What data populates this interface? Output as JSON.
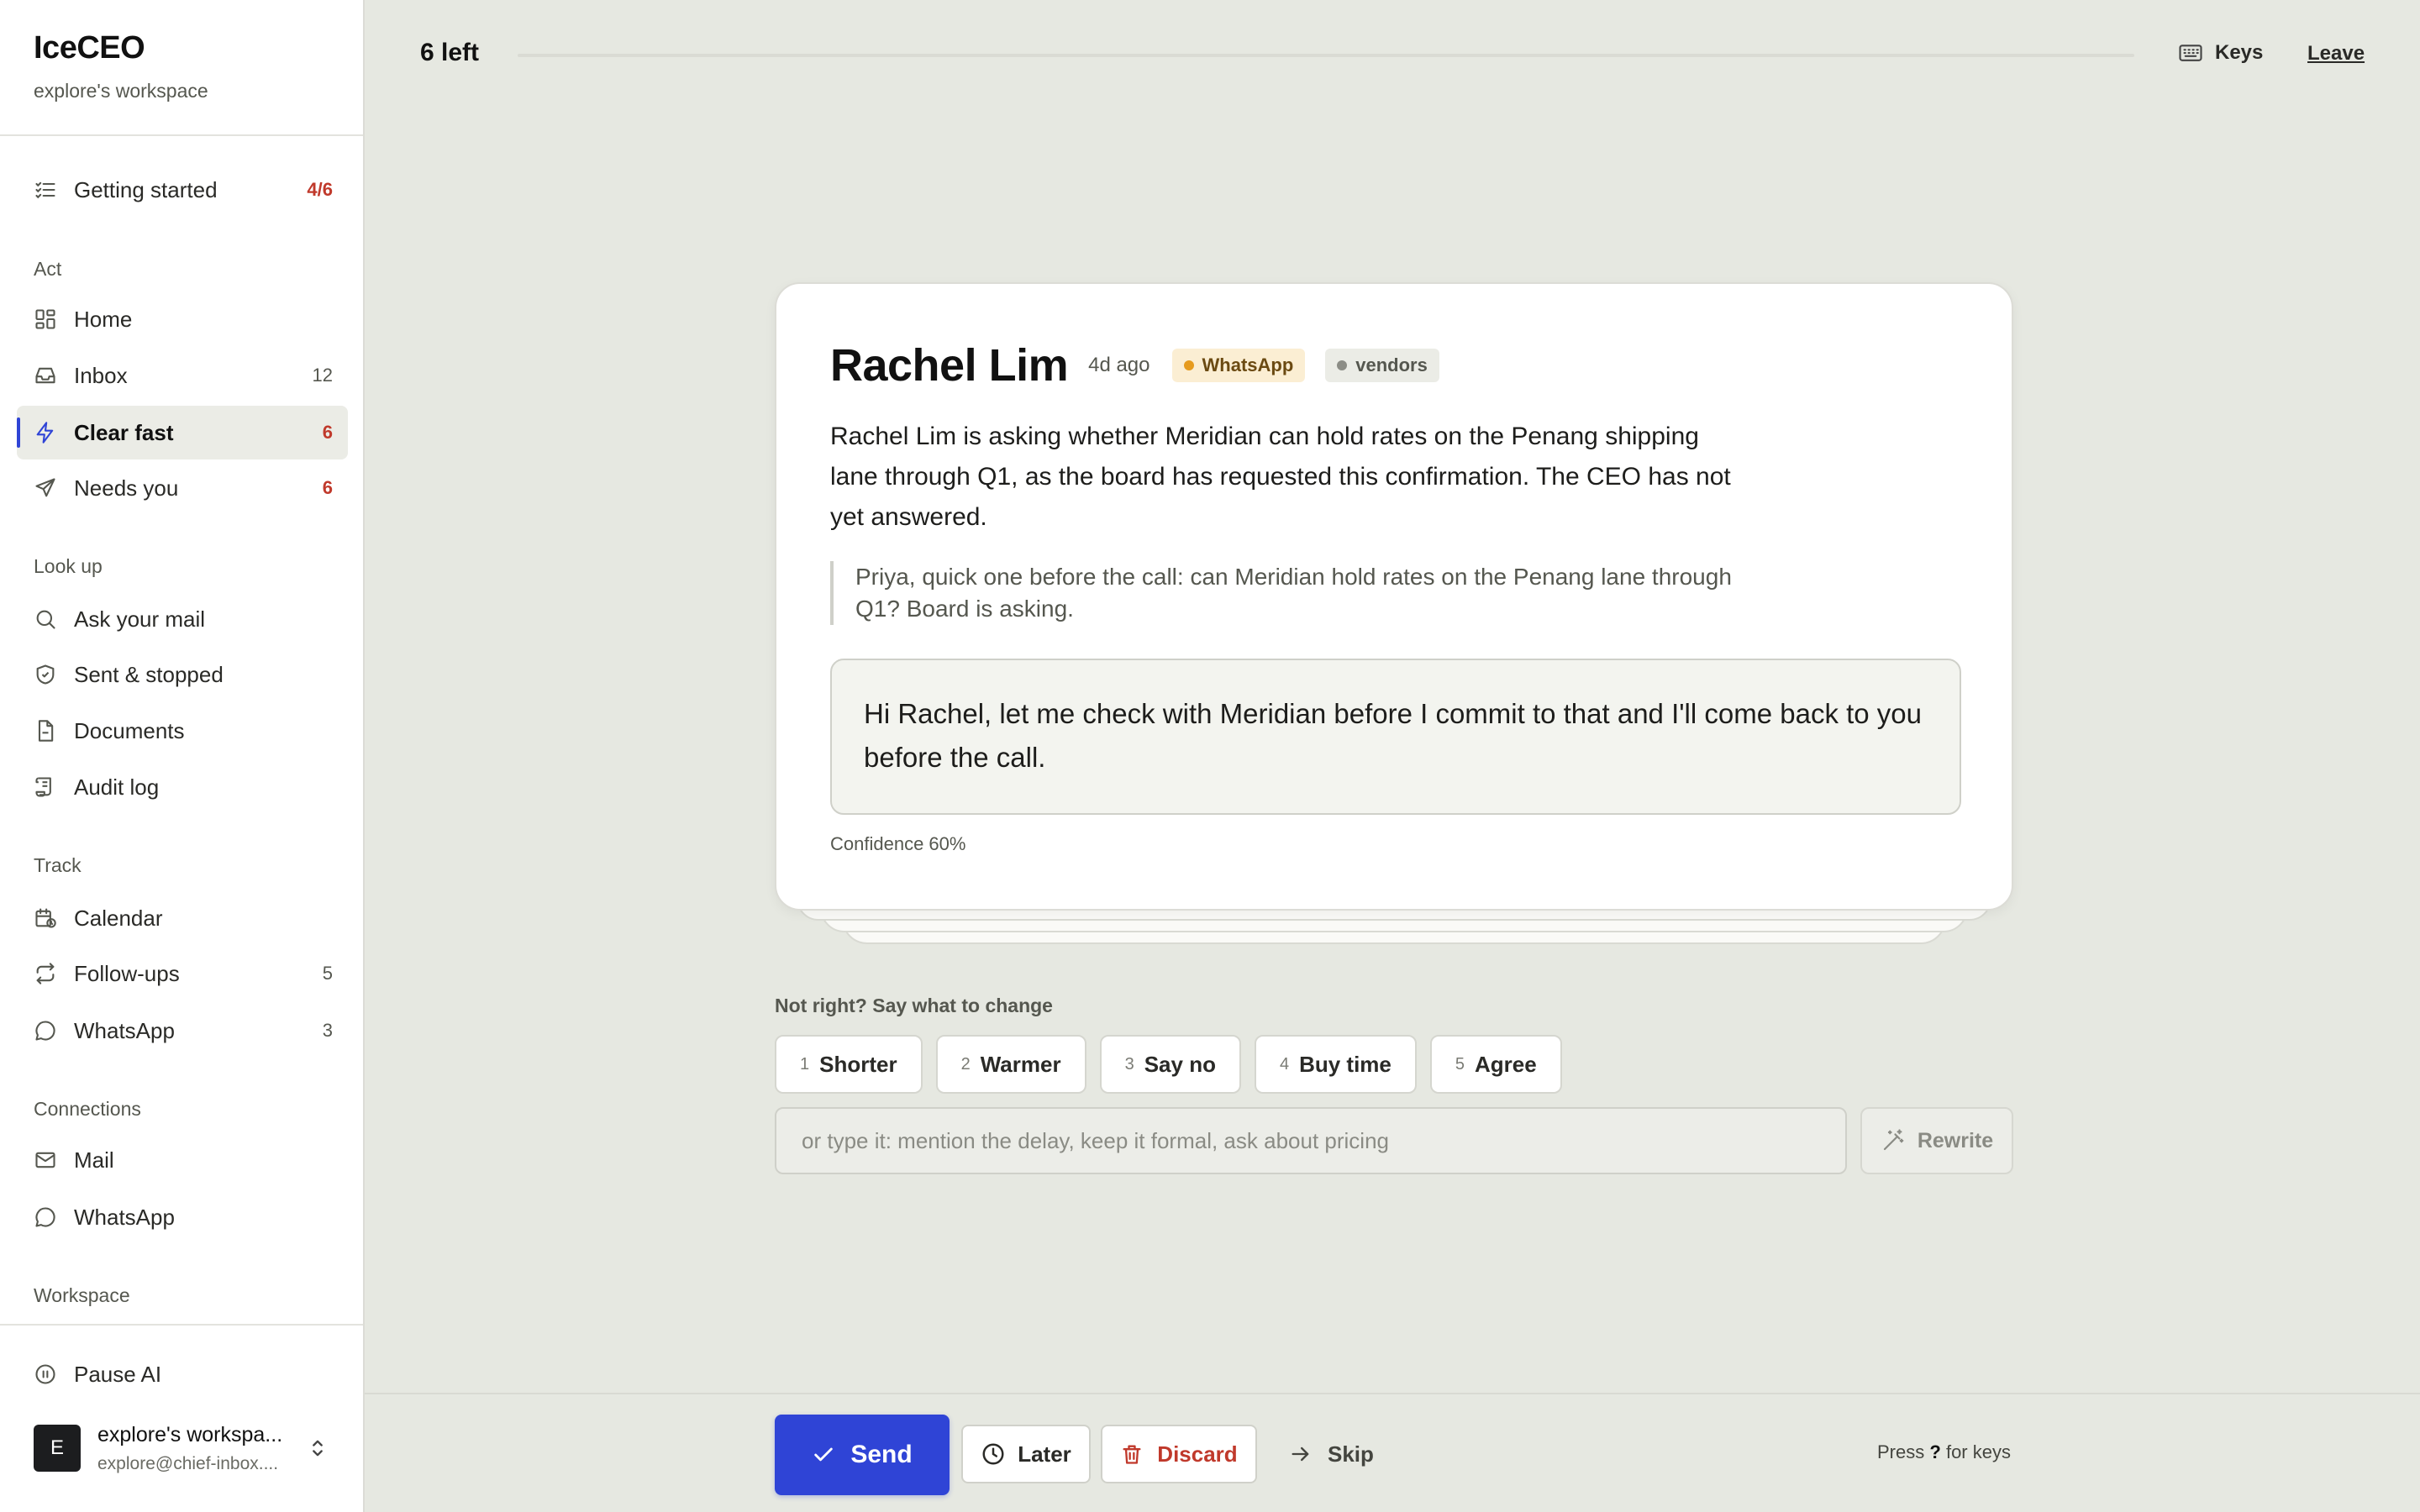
{
  "brand": {
    "title": "IceCEO",
    "workspace": "explore's workspace"
  },
  "sidebar": {
    "getting_started": {
      "label": "Getting started",
      "count": "4/6",
      "icon": "checklist-icon"
    },
    "sections": {
      "act": "Act",
      "lookup": "Look up",
      "track": "Track",
      "connections": "Connections",
      "workspace": "Workspace"
    },
    "act_items": [
      {
        "label": "Home",
        "count": "",
        "icon": "grid-icon"
      },
      {
        "label": "Inbox",
        "count": "12",
        "icon": "inbox-icon"
      },
      {
        "label": "Clear fast",
        "count": "6",
        "icon": "lightning-icon",
        "active": true
      },
      {
        "label": "Needs you",
        "count": "6",
        "icon": "send-icon"
      }
    ],
    "lookup_items": [
      {
        "label": "Ask your mail",
        "icon": "search-icon"
      },
      {
        "label": "Sent & stopped",
        "icon": "shield-icon"
      },
      {
        "label": "Documents",
        "icon": "document-icon"
      },
      {
        "label": "Audit log",
        "icon": "scroll-icon"
      }
    ],
    "track_items": [
      {
        "label": "Calendar",
        "count": "",
        "icon": "calendar-icon"
      },
      {
        "label": "Follow-ups",
        "count": "5",
        "icon": "repeat-icon"
      },
      {
        "label": "WhatsApp",
        "count": "3",
        "icon": "chat-icon"
      }
    ],
    "connection_items": [
      {
        "label": "Mail",
        "icon": "mail-icon"
      },
      {
        "label": "WhatsApp",
        "icon": "chat-icon"
      }
    ],
    "pause_ai": "Pause AI",
    "account": {
      "initial": "E",
      "name": "explore's workspa...",
      "email": "explore@chief-inbox...."
    }
  },
  "topbar": {
    "remaining": "6 left",
    "progress_fraction": 0.0,
    "keys_label": "Keys",
    "leave_label": "Leave"
  },
  "card": {
    "contact": "Rachel Lim",
    "ago": "4d ago",
    "channel": "WhatsApp",
    "tag": "vendors",
    "summary": "Rachel Lim is asking whether Meridian can hold rates on the Penang shipping lane through Q1, as the board has requested this confirmation. The CEO has not yet answered.",
    "quote": "Priya, quick one before the call: can Meridian hold rates on the Penang lane through Q1? Board is asking.",
    "draft": "Hi Rachel, let me check with Meridian before I commit to that and I'll come back to you before the call.",
    "confidence": "Confidence 60%"
  },
  "refine": {
    "label": "Not right? Say what to change",
    "options": [
      {
        "key": "1",
        "label": "Shorter"
      },
      {
        "key": "2",
        "label": "Warmer"
      },
      {
        "key": "3",
        "label": "Say no"
      },
      {
        "key": "4",
        "label": "Buy time"
      },
      {
        "key": "5",
        "label": "Agree"
      }
    ],
    "placeholder": "or type it: mention the delay, keep it formal, ask about pricing",
    "rewrite_label": "Rewrite"
  },
  "actions": {
    "send": "Send",
    "later": "Later",
    "discard": "Discard",
    "skip": "Skip",
    "hint_prefix": "Press",
    "hint_key": "?",
    "hint_suffix": "for keys"
  },
  "colors": {
    "accent": "#2f44d6",
    "danger": "#c0392b",
    "background": "#e6e8e1",
    "whatsapp_dot": "#e69b1e"
  }
}
